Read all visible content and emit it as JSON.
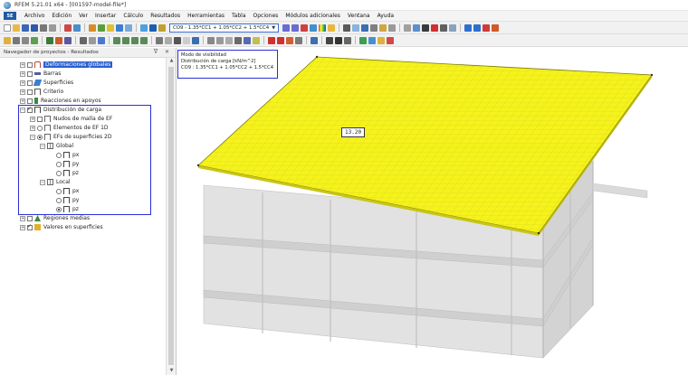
{
  "window": {
    "title": "RFEM 5.21.01 x64 - [001597-model-file*]"
  },
  "menu": {
    "logo": "5E",
    "items": [
      "Archivo",
      "Edición",
      "Ver",
      "Insertar",
      "Cálculo",
      "Resultados",
      "Herramientas",
      "Tabla",
      "Opciones",
      "Módulos adicionales",
      "Ventana",
      "Ayuda"
    ]
  },
  "toolbar": {
    "load_combo": "CO9 - 1.35*CC1 + 1.05*CC2 + 1.5*CC4"
  },
  "navigator": {
    "title": "Navegador de proyectos - Resultados",
    "pin_close": "ᐁ ✕",
    "items": [
      {
        "label": "Deformaciones globales",
        "highlight": true
      },
      {
        "label": "Barras"
      },
      {
        "label": "Superficies"
      },
      {
        "label": "Criterio"
      },
      {
        "label": "Reacciones en apoyos"
      },
      {
        "label": "Distribución de carga"
      },
      {
        "label": "Nudos de malla de EF"
      },
      {
        "label": "Elementos de EF 1D"
      },
      {
        "label": "EFs de superficies 2D"
      },
      {
        "label": "Global"
      },
      {
        "label": "px"
      },
      {
        "label": "py"
      },
      {
        "label": "pz"
      },
      {
        "label": "Local"
      },
      {
        "label": "px"
      },
      {
        "label": "py"
      },
      {
        "label": "pz"
      },
      {
        "label": "Regiones medias"
      },
      {
        "label": "Valores en superficies"
      }
    ]
  },
  "viewport": {
    "info": {
      "line1": "Modo de visibilidad",
      "line2": "Distribución de carga [kN/m^2]",
      "line3": "CO9 : 1.35*CC1 + 1.05*CC2 + 1.5*CC4"
    },
    "value_label": "13.20",
    "slab_color": "#f5f21c",
    "structure_color": "#d6d6d6"
  }
}
